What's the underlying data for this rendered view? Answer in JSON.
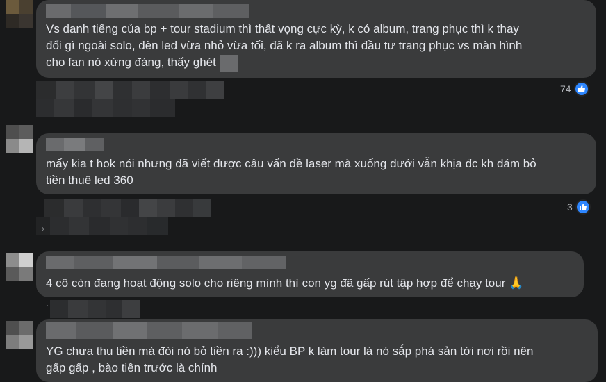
{
  "comments": [
    {
      "lines": [
        "Vs danh tiếng của bp + tour stadium thì thất vọng cực kỳ, k có album,   trang phục thì k thay",
        "đổi gì ngoài solo, đèn led vừa nhỏ vừa tối, đã k ra album thì đầu tư trang phục vs màn hình",
        "cho fan nó xứng đáng, thấy ghét"
      ],
      "reactions": "74"
    },
    {
      "lines": [
        "mấy kia t hok nói nhưng đã viết được câu vấn đề laser mà xuống dưới vẫn khịa đc kh dám bỏ",
        "tiền thuê led 360"
      ],
      "reactions": "3"
    },
    {
      "lines": [
        "4 cô còn đang hoạt động solo cho riêng mình thì con yg đã gấp rút tập hợp để chạy tour 🙏"
      ]
    },
    {
      "lines": [
        "YG chưa thu tiền mà đòi nó bỏ tiền ra :))) kiểu BP k làm tour là nó sắp phá sản tới nơi rồi nên",
        "gấp gấp , bào tiền trước là chính"
      ]
    }
  ],
  "icons": {
    "like": "like-thumb-icon"
  },
  "colors": {
    "background": "#18191a",
    "bubble": "#3a3b3c",
    "text": "#e4e6eb",
    "like_blue": "#2d86ff"
  }
}
